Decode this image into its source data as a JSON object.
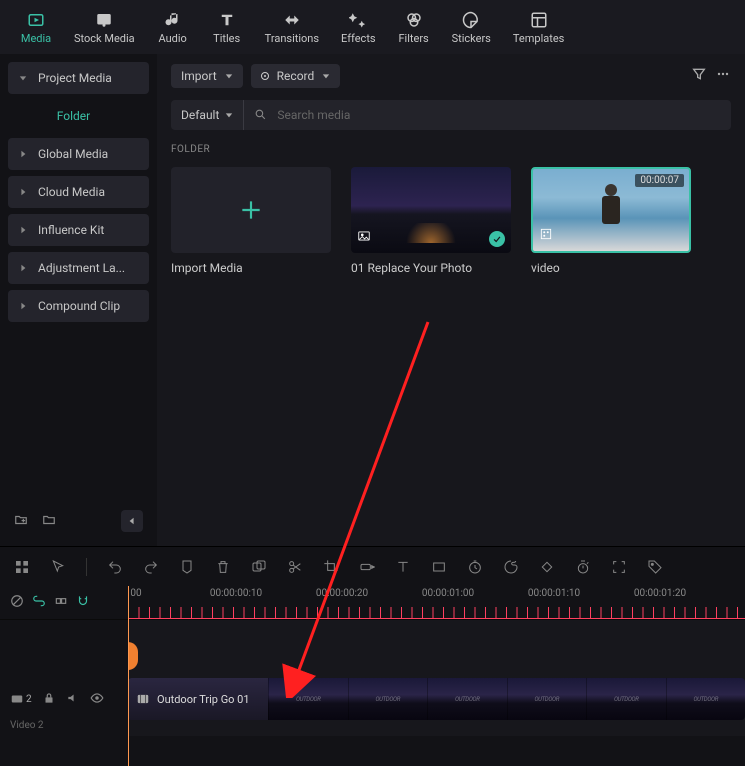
{
  "topnav": {
    "media": "Media",
    "stock_media": "Stock Media",
    "audio": "Audio",
    "titles": "Titles",
    "transitions": "Transitions",
    "effects": "Effects",
    "filters": "Filters",
    "stickers": "Stickers",
    "templates": "Templates"
  },
  "sidebar": {
    "project_media": "Project Media",
    "folder": "Folder",
    "global_media": "Global Media",
    "cloud_media": "Cloud Media",
    "influence_kit": "Influence Kit",
    "adjustment": "Adjustment La...",
    "compound": "Compound Clip"
  },
  "content": {
    "import_btn": "Import",
    "record_btn": "Record",
    "default_label": "Default",
    "search_placeholder": "Search media",
    "folder_heading": "FOLDER"
  },
  "tiles": {
    "import_label": "Import Media",
    "replace_label": "01 Replace Your Photo",
    "video_label": "video",
    "video_duration": "00:00:07"
  },
  "ruler": {
    "t0": "00",
    "t1": "00:00:00:10",
    "t2": "00:00:00:20",
    "t3": "00:00:01:00",
    "t4": "00:00:01:10",
    "t5": "00:00:01:20"
  },
  "track": {
    "row_count": "2",
    "row2_label": "Video 2"
  },
  "clip": {
    "name": "Outdoor Trip Go 01",
    "frame_text": "OUTDOOR"
  }
}
